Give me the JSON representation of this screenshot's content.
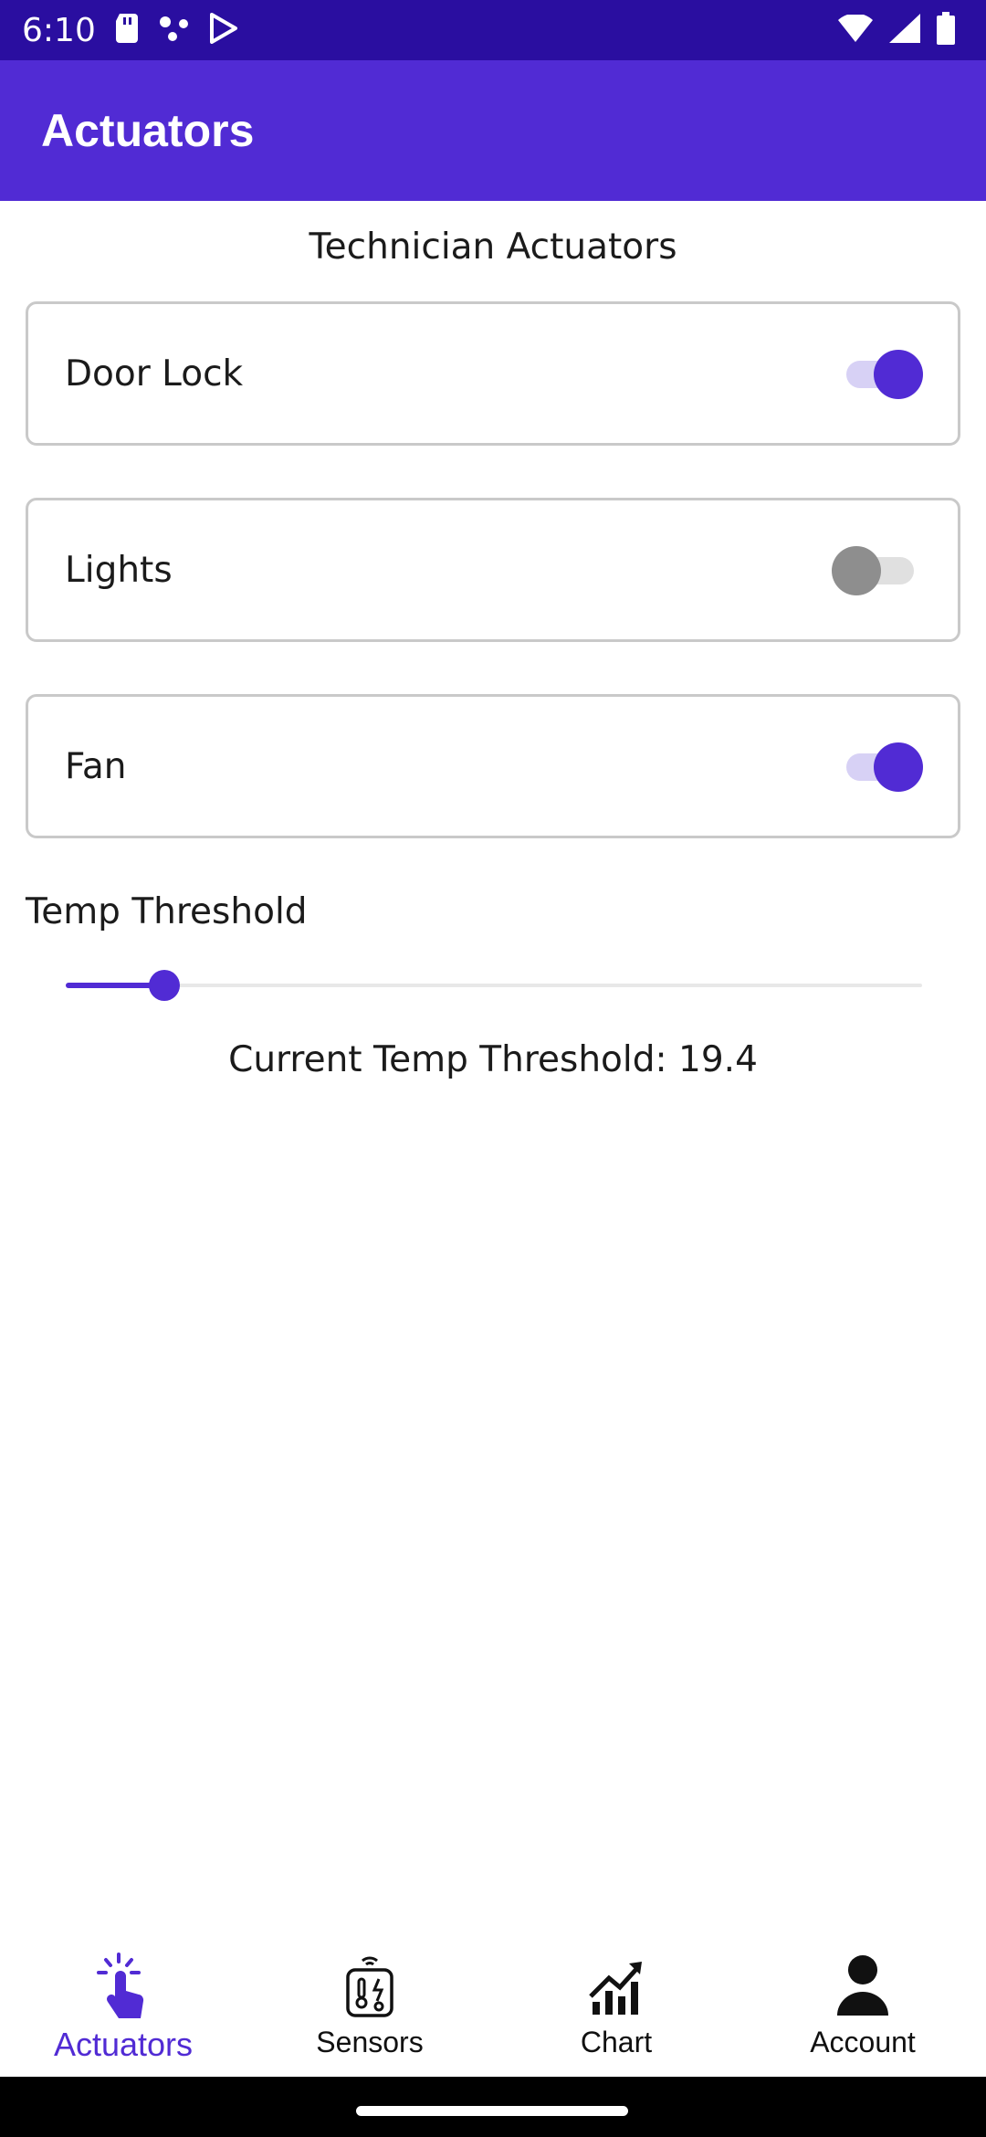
{
  "status_bar": {
    "time": "6:10",
    "icons": [
      "sd-card-icon",
      "dots-icon",
      "play-store-icon",
      "wifi-icon",
      "signal-icon",
      "battery-icon"
    ]
  },
  "app_bar": {
    "title": "Actuators"
  },
  "section_title": "Technician Actuators",
  "actuators": [
    {
      "label": "Door Lock",
      "on": true
    },
    {
      "label": "Lights",
      "on": false
    },
    {
      "label": "Fan",
      "on": true
    }
  ],
  "temp_threshold": {
    "label": "Temp Threshold",
    "value_fraction": 0.115,
    "value_text": "Current Temp Threshold: 19.4"
  },
  "bottom_nav": {
    "items": [
      {
        "label": "Actuators",
        "icon": "touch-hand-icon",
        "active": true
      },
      {
        "label": "Sensors",
        "icon": "sensor-device-icon",
        "active": false
      },
      {
        "label": "Chart",
        "icon": "chart-growth-icon",
        "active": false
      },
      {
        "label": "Account",
        "icon": "person-icon",
        "active": false
      }
    ]
  },
  "colors": {
    "accent": "#512bd4",
    "status_bar": "#2a0ea0"
  }
}
